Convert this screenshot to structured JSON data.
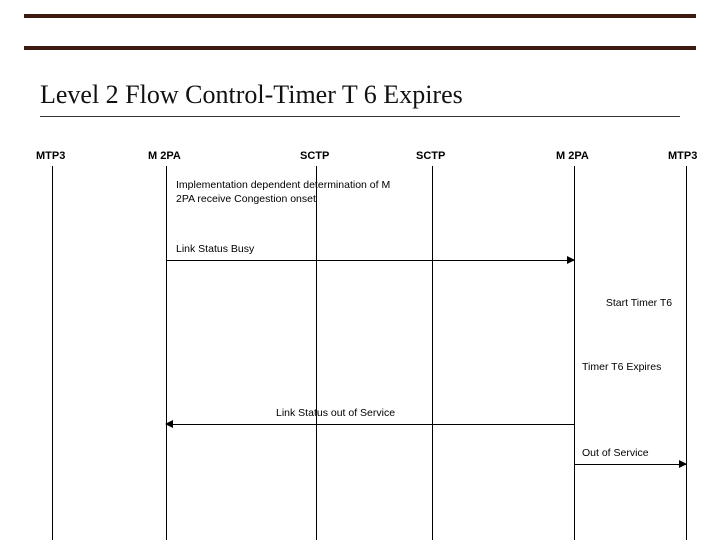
{
  "slide": {
    "title": "Level 2 Flow Control-Timer T 6 Expires"
  },
  "lanes": {
    "mtp3_left": "MTP3",
    "m2pa_left": "M 2PA",
    "sctp_left": "SCTP",
    "sctp_right": "SCTP",
    "m2pa_right": "M 2PA",
    "mtp3_right": "MTP3"
  },
  "annotations": {
    "impl_dep": "Implementation dependent determination of M 2PA receive Congestion onset",
    "link_status_busy": "Link Status Busy",
    "start_timer": "Start Timer T6",
    "timer_expires": "Timer T6 Expires",
    "link_out": "Link Status out of  Service",
    "out_of_service": "Out of Service"
  },
  "chart_data": {
    "type": "sequence-diagram",
    "title": "Level 2 Flow Control-Timer T 6 Expires",
    "participants": [
      "MTP3",
      "M 2PA",
      "SCTP",
      "SCTP",
      "M 2PA",
      "MTP3"
    ],
    "events": [
      {
        "kind": "note",
        "at": "M 2PA (left)",
        "text": "Implementation dependent determination of M 2PA receive Congestion onset"
      },
      {
        "kind": "message",
        "from": "M 2PA (left)",
        "to": "M 2PA (right)",
        "label": "Link Status Busy"
      },
      {
        "kind": "note",
        "at": "M 2PA (right)",
        "text": "Start Timer T6"
      },
      {
        "kind": "note",
        "at": "M 2PA (right)",
        "text": "Timer T6 Expires"
      },
      {
        "kind": "message",
        "from": "M 2PA (right)",
        "to": "M 2PA (left)",
        "label": "Link Status out of Service"
      },
      {
        "kind": "message",
        "from": "M 2PA (right)",
        "to": "MTP3 (right)",
        "label": "Out of Service"
      }
    ]
  }
}
